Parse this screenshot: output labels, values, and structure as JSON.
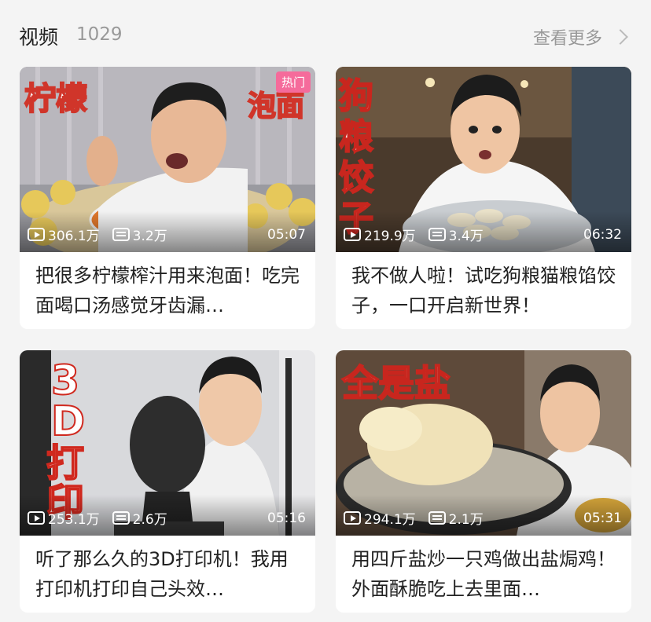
{
  "header": {
    "title": "视频",
    "count": "1029",
    "more_label": "查看更多"
  },
  "colors": {
    "hot_badge": "#f56b9b",
    "background": "#f4f4f4"
  },
  "videos": [
    {
      "thumbnail_text": [
        "柠檬",
        "泡面"
      ],
      "badge": "热门",
      "plays": "306.1万",
      "danmaku": "3.2万",
      "duration": "05:07",
      "title": "把很多柠檬榨汁用来泡面！吃完面喝口汤感觉牙齿漏…"
    },
    {
      "thumbnail_text": [
        "狗",
        "粮",
        "饺",
        "子"
      ],
      "plays": "219.9万",
      "danmaku": "3.4万",
      "duration": "06:32",
      "title": "我不做人啦！试吃狗粮猫粮馅饺子，一口开启新世界！"
    },
    {
      "thumbnail_text": [
        "3",
        "D",
        "打",
        "印"
      ],
      "plays": "253.1万",
      "danmaku": "2.6万",
      "duration": "05:16",
      "title": "听了那么久的3D打印机！我用打印机打印自己头效…"
    },
    {
      "thumbnail_text": [
        "全是盐"
      ],
      "plays": "294.1万",
      "danmaku": "2.1万",
      "duration": "05:31",
      "title": "用四斤盐炒一只鸡做出盐焗鸡！外面酥脆吃上去里面…"
    }
  ]
}
